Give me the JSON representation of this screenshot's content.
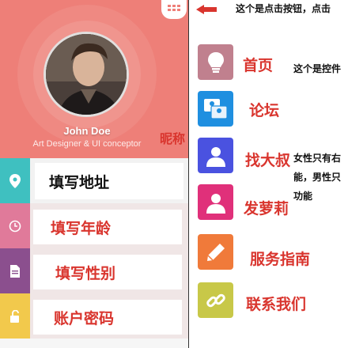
{
  "profile": {
    "name": "John Doe",
    "role": "Art Designer & UI conceptor"
  },
  "form_rows": [
    {
      "label": "填写地址",
      "icon": "location-pin-icon",
      "color": "#3fc0c0",
      "text_color": "#111111"
    },
    {
      "label": "填写年龄",
      "icon": "clock-icon",
      "color": "#e07a9a",
      "text_color": "#d9352e"
    },
    {
      "label": "填写性别",
      "icon": "document-icon",
      "color": "#8b4f8e",
      "text_color": "#d9352e"
    },
    {
      "label": "账户密码",
      "icon": "unlock-icon",
      "color": "#f2c94c",
      "text_color": "#d9352e"
    }
  ],
  "annotations": {
    "nickname": "昵称",
    "top": "这个是点击按钮，点击",
    "home": "这个是控件",
    "gender": "女性只有右\n能，男性只\n功能"
  },
  "menu": [
    {
      "label": "首页",
      "icon": "lightbulb-icon",
      "color": "#c0808e"
    },
    {
      "label": "论坛",
      "icon": "users-icon",
      "color": "#1f8fe0"
    },
    {
      "label": "找大叔",
      "icon": "user-icon",
      "color": "#4a52e0"
    },
    {
      "label": "发萝莉",
      "icon": "user-female-icon",
      "color": "#e0307a"
    },
    {
      "label": "服务指南",
      "icon": "pencil-icon",
      "color": "#f07a3a"
    },
    {
      "label": "联系我们",
      "icon": "link-icon",
      "color": "#c8c848"
    }
  ],
  "colors": {
    "header": "#ee7f78",
    "accent_red": "#d9352e"
  }
}
